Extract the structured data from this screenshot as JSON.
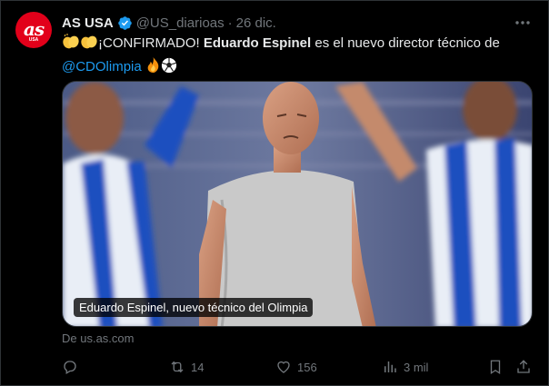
{
  "author": {
    "name": "AS USA",
    "handle": "@US_diarioas",
    "date": "26 dic.",
    "separator": "·",
    "avatar_text": "as",
    "avatar_sub": "USA"
  },
  "tweet": {
    "part1": "¡CONFIRMADO! ",
    "bold": "Eduardo Espinel",
    "part2": " es el nuevo director técnico de",
    "mention": "@CDOlimpia"
  },
  "media": {
    "caption": "Eduardo Espinel, nuevo técnico del Olimpia"
  },
  "source": "De us.as.com",
  "actions": {
    "retweets": "14",
    "likes": "156",
    "views": "3 mil"
  },
  "colors": {
    "accent": "#1d9bf0",
    "brand": "#e2001a",
    "muted": "#71767b",
    "background": "#000000"
  },
  "icons": [
    "verified-icon",
    "more-icon",
    "clap-emoji",
    "fire-emoji",
    "soccer-ball-emoji",
    "reply-icon",
    "retweet-icon",
    "like-icon",
    "views-icon",
    "bookmark-icon",
    "share-icon"
  ]
}
